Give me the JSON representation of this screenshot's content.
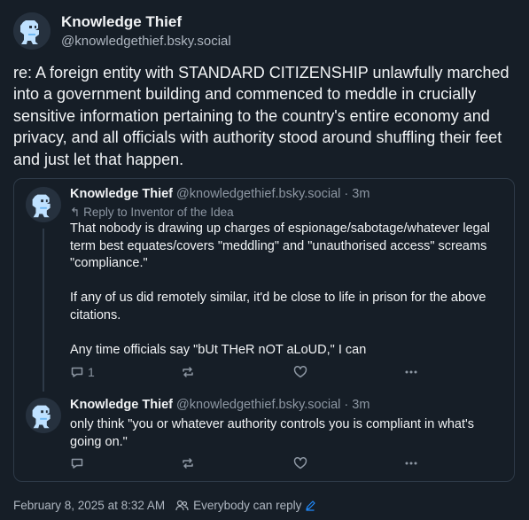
{
  "author": {
    "name": "Knowledge Thief",
    "handle": "@knowledgethief.bsky.social"
  },
  "post": {
    "text": "re: A foreign entity with STANDARD CITIZENSHIP unlawfully marched into a government building and commenced to meddle in crucially sensitive information pertaining to the country's entire economy and privacy, and all officials with authority stood around shuffling their feet and just let that happen."
  },
  "quote": {
    "posts": [
      {
        "name": "Knowledge Thief",
        "handle": "@knowledgethief.bsky.social",
        "dot": "·",
        "time": "3m",
        "reply_to": "Reply to Inventor of the Idea",
        "paragraphs": [
          "That nobody is drawing up charges of espionage/sabotage/whatever legal term best equates/covers \"meddling\" and \"unauthorised access\" screams \"compliance.\"",
          "If any of us did remotely similar, it'd be close to life in prison for the above citations.",
          "Any time officials say \"bUt THeR nOT aLoUD,\" I can"
        ],
        "reply_count": "1",
        "icons": [
          "reply-icon",
          "repost-icon",
          "like-icon",
          "more-icon"
        ]
      },
      {
        "name": "Knowledge Thief",
        "handle": "@knowledgethief.bsky.social",
        "dot": "·",
        "time": "3m",
        "paragraphs": [
          "only think \"you or whatever authority controls you is compliant in what's going on.\""
        ],
        "icons": [
          "reply-icon",
          "repost-icon",
          "like-icon",
          "more-icon"
        ]
      }
    ]
  },
  "footer": {
    "date": "February 8, 2025 at 8:32 AM",
    "reply_setting": "Everybody can reply"
  },
  "colors": {
    "background": "#161e27",
    "text": "#f1f3f5",
    "muted": "#8d97a3",
    "border": "#2e3a48",
    "accent": "#208bfe"
  }
}
